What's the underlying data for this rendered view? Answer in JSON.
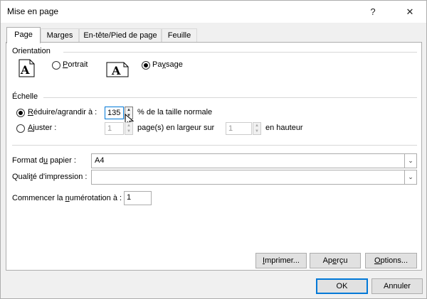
{
  "window": {
    "title": "Mise en page",
    "help_glyph": "?",
    "close_glyph": "✕"
  },
  "tabs": [
    {
      "label": "Page",
      "active": true
    },
    {
      "label": "Marges",
      "active": false
    },
    {
      "label": "En-tête/Pied de page",
      "active": false
    },
    {
      "label": "Feuille",
      "active": false
    }
  ],
  "orientation": {
    "group_label": "Orientation",
    "icon_glyph": "A",
    "portrait": {
      "pre": "",
      "accel": "P",
      "post": "ortrait",
      "checked": false
    },
    "paysage": {
      "pre": "Pa",
      "accel": "y",
      "post": "sage",
      "checked": true
    }
  },
  "scale": {
    "group_label": "Échelle",
    "reduce": {
      "pre": "",
      "accel": "R",
      "post": "éduire/agrandir à :",
      "checked": true
    },
    "reduce_value": "135",
    "reduce_suffix": "% de la taille normale",
    "fit": {
      "pre": "",
      "accel": "A",
      "post": "juster :",
      "checked": false
    },
    "fit_width_value": "1",
    "fit_width_suffix": "page(s) en largeur sur",
    "fit_height_value": "1",
    "fit_height_suffix": "en hauteur"
  },
  "paper": {
    "label_pre": "Format d",
    "label_accel": "u",
    "label_post": " papier :",
    "value": "A4"
  },
  "quality": {
    "label_pre": "Quali",
    "label_accel": "t",
    "label_post": "é d'impression :",
    "value": ""
  },
  "numbering": {
    "label_pre": "Commencer la ",
    "label_accel": "n",
    "label_post": "umérotation à :",
    "value": "1"
  },
  "buttons": {
    "print": {
      "pre": "",
      "accel": "I",
      "post": "mprimer..."
    },
    "preview": {
      "pre": "Ap",
      "accel": "e",
      "post": "rçu"
    },
    "options": {
      "pre": "",
      "accel": "O",
      "post": "ptions..."
    },
    "ok": "OK",
    "cancel": "Annuler"
  },
  "colors": {
    "accent": "#0078d7",
    "panel_bg": "#ffffff",
    "dialog_bg": "#f0f0f0"
  },
  "icons": {
    "spin_up": "▲",
    "spin_down": "▼",
    "dropdown": "⌄"
  }
}
